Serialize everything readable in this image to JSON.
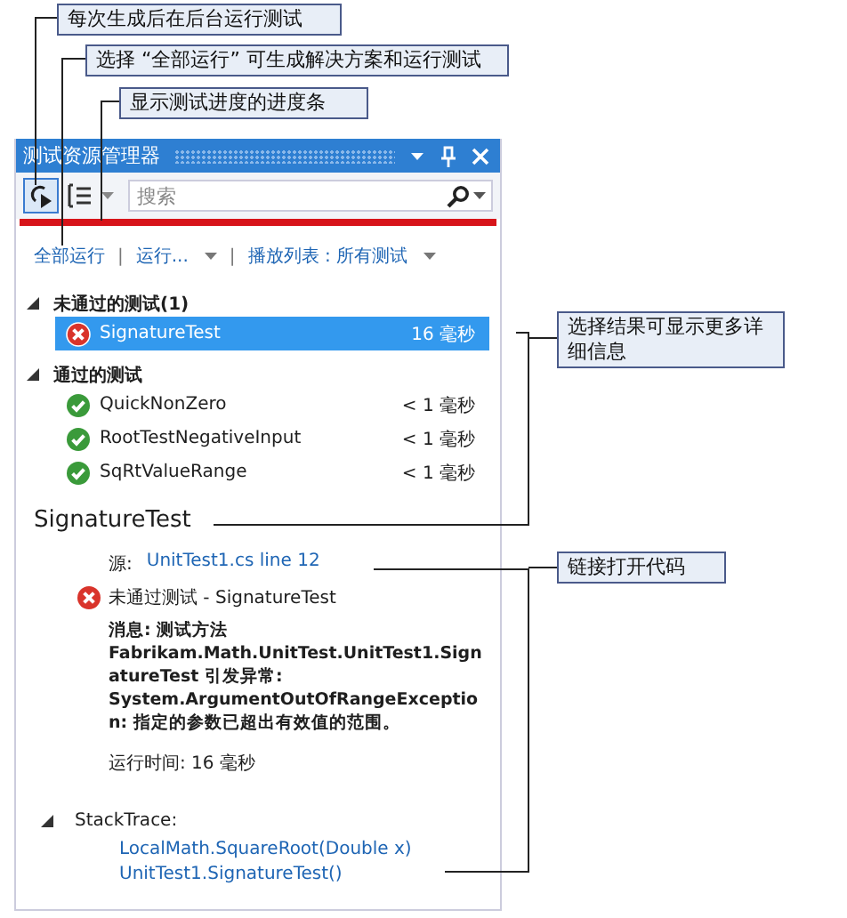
{
  "callouts": [
    {
      "text": "每次生成后在后台运行测试"
    },
    {
      "text": "选择 “全部运行” 可生成解决方案和运行测试"
    },
    {
      "text": "显示测试进度的进度条"
    },
    {
      "text": "选择结果可显示更多详细信息"
    },
    {
      "text": "链接打开代码"
    }
  ],
  "window": {
    "title": "测试资源管理器"
  },
  "toolbar": {
    "run_after_build": {
      "on": true
    },
    "search": {
      "placeholder": "搜索"
    }
  },
  "progress": {
    "level": 1,
    "kind": "failed"
  },
  "links": [
    {
      "label": "全部运行",
      "dropdown": false
    },
    {
      "separator": "|",
      "label": "运行...",
      "dropdown": true
    },
    {
      "separator": "|",
      "label": "播放列表 : 所有测试",
      "dropdown": true
    }
  ],
  "groups": [
    {
      "title": "未通过的测试",
      "count": "(1)",
      "expanded": true,
      "tests": [
        {
          "name": "SignatureTest",
          "duration": "16 毫秒",
          "kind": "failed",
          "selected": true
        }
      ]
    },
    {
      "title": "通过的测试",
      "expanded": true,
      "tests": [
        {
          "name": "QuickNonZero",
          "duration": "< 1 毫秒",
          "kind": "passed",
          "selected": false
        },
        {
          "name": "RootTestNegativeInput",
          "duration": "< 1 毫秒",
          "kind": "passed",
          "selected": false
        },
        {
          "name": "SqRtValueRange",
          "duration": "< 1 毫秒",
          "kind": "passed",
          "selected": false
        }
      ]
    }
  ],
  "detail": {
    "title": "SignatureTest",
    "source_label": "源:",
    "source_link": "UnitTest1.cs line 12",
    "kind": "failed",
    "result": "未通过测试 - SignatureTest",
    "message": "消息: 测试方法 Fabrikam.Math.UnitTest.UnitTest1.SignatureTest 引发异常: System.ArgumentOutOfRangeException: 指定的参数已超出有效值的范围。",
    "elapsed": "运行时间: 16 毫秒",
    "stack_trace": {
      "label": "StackTrace:",
      "expanded": true,
      "frames": [
        "LocalMath.SquareRoot(Double x)",
        "UnitTest1.SignatureTest()"
      ]
    }
  }
}
